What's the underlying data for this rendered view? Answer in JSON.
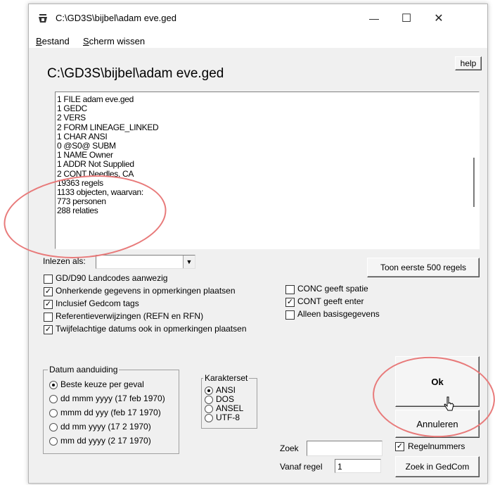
{
  "window": {
    "title": "C:\\GD3S\\bijbel\\adam eve.ged",
    "minimize_glyph": "—",
    "maximize_glyph": "☐",
    "close_glyph": "✕"
  },
  "menu": {
    "bestand_first": "B",
    "bestand_rest": "estand",
    "scherm_first": "S",
    "scherm_rest": "cherm wissen"
  },
  "header": {
    "filename": "C:\\GD3S\\bijbel\\adam eve.ged",
    "help_label": "help"
  },
  "log_lines": [
    "1 FILE adam eve.ged",
    "1 GEDC",
    "2 VERS",
    "2 FORM LINEAGE_LINKED",
    "1 CHAR ANSI",
    "0 @S0@ SUBM",
    "1 NAME Owner",
    "1 ADDR Not Supplied",
    "2 CONT Needles, CA",
    "19363 regels",
    "1133 objecten, waarvan:",
    "773 personen",
    "288 relaties"
  ],
  "read_as": {
    "label": "Inlezen als:",
    "value": ""
  },
  "show_first_label": "Toon eerste 500 regels",
  "options_left": [
    {
      "label": "GD/D90 Landcodes aanwezig",
      "checked": false
    },
    {
      "label": "Onherkende gegevens in opmerkingen plaatsen",
      "checked": true
    },
    {
      "label": "Inclusief Gedcom tags",
      "checked": true
    },
    {
      "label": "Referentieverwijzingen (REFN en RFN)",
      "checked": false
    },
    {
      "label": "Twijfelachtige datums ook in opmerkingen plaatsen",
      "checked": true
    }
  ],
  "options_right": [
    {
      "label": "CONC geeft spatie",
      "checked": false
    },
    {
      "label": "CONT geeft enter",
      "checked": true
    },
    {
      "label": "Alleen basisgegevens",
      "checked": false
    }
  ],
  "date_group": {
    "legend": "Datum aanduiding",
    "options": [
      {
        "label": "Beste keuze per geval",
        "selected": true
      },
      {
        "label": "dd mmm yyyy (17 feb 1970)",
        "selected": false
      },
      {
        "label": "mmm dd yyy (feb 17 1970)",
        "selected": false
      },
      {
        "label": "dd mm yyyy (17 2 1970)",
        "selected": false
      },
      {
        "label": "mm dd yyyy (2 17 1970)",
        "selected": false
      }
    ]
  },
  "charset_group": {
    "legend": "Karakterset",
    "options": [
      {
        "label": "ANSI",
        "selected": true
      },
      {
        "label": "DOS",
        "selected": false
      },
      {
        "label": "ANSEL",
        "selected": false
      },
      {
        "label": "UTF-8",
        "selected": false
      }
    ]
  },
  "buttons": {
    "ok": "Ok",
    "cancel": "Annuleren",
    "search_gedcom": "Zoek in GedCom"
  },
  "search": {
    "label": "Zoek",
    "value": ""
  },
  "from_line": {
    "label": "Vanaf regel",
    "value": "1"
  },
  "line_numbers": {
    "label": "Regelnummers",
    "checked": true
  },
  "annotation_color": "#e87a7a"
}
